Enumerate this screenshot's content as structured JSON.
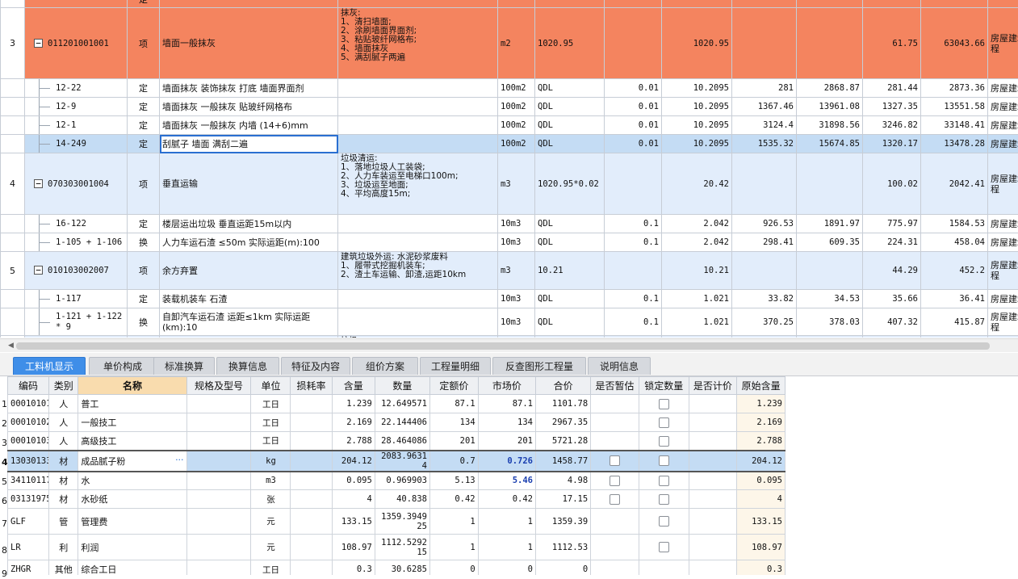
{
  "top_rows": [
    {
      "type": "orange",
      "rn": "",
      "code": "",
      "kind": "定",
      "name": "",
      "desc": "",
      "unit": "",
      "qty_expr": "",
      "content": "",
      "qty": "",
      "unit_price": "",
      "total": "",
      "composite_price": "",
      "composite_total": "",
      "specialty": ""
    },
    {
      "type": "orange",
      "rn": "3",
      "code": "011201001001",
      "toggle": "−",
      "kind": "项",
      "name": "墙面一般抹灰",
      "desc": "抹灰:\n1、清扫墙面;\n2、涂刷墙面界面剂;\n3、粘贴玻纤网格布;\n4、墙面抹灰\n5、满刮腻子两遍",
      "unit": "m2",
      "qty_expr": "1020.95",
      "content": "",
      "qty": "1020.95",
      "unit_price": "",
      "total": "",
      "composite_price": "61.75",
      "composite_total": "63043.66",
      "specialty": "房屋建筑工程"
    },
    {
      "type": "white",
      "rn": "",
      "code": "12-22",
      "kind": "定",
      "name": "墙面抹灰 装饰抹灰 打底 墙面界面剂",
      "desc": "",
      "unit": "100m2",
      "qty_expr": "QDL",
      "content": "0.01",
      "qty": "10.2095",
      "unit_price": "281",
      "total": "2868.87",
      "composite_price": "281.44",
      "composite_total": "2873.36",
      "specialty": "房屋建筑"
    },
    {
      "type": "white",
      "rn": "",
      "code": "12-9",
      "kind": "定",
      "name": "墙面抹灰 一般抹灰 贴玻纤网格布",
      "desc": "",
      "unit": "100m2",
      "qty_expr": "QDL",
      "content": "0.01",
      "qty": "10.2095",
      "unit_price": "1367.46",
      "total": "13961.08",
      "composite_price": "1327.35",
      "composite_total": "13551.58",
      "specialty": "房屋建筑"
    },
    {
      "type": "white",
      "rn": "",
      "code": "12-1",
      "kind": "定",
      "name": "墙面抹灰 一般抹灰 内墙 (14+6)mm",
      "desc": "",
      "unit": "100m2",
      "qty_expr": "QDL",
      "content": "0.01",
      "qty": "10.2095",
      "unit_price": "3124.4",
      "total": "31898.56",
      "composite_price": "3246.82",
      "composite_total": "33148.41",
      "specialty": "房屋建筑"
    },
    {
      "type": "selected",
      "rn": "",
      "code": "14-249",
      "kind": "定",
      "name": "刮腻子 墙面 满刮二遍",
      "desc": "",
      "unit": "100m2",
      "qty_expr": "QDL",
      "content": "0.01",
      "qty": "10.2095",
      "unit_price": "1535.32",
      "total": "15674.85",
      "composite_price": "1320.17",
      "composite_total": "13478.28",
      "specialty": "房屋建筑"
    },
    {
      "type": "blue",
      "rn": "4",
      "code": "070303001004",
      "toggle": "−",
      "kind": "项",
      "name": "垂直运输",
      "desc": "垃圾清运:\n1、落地垃圾人工装袋;\n2、人力车装运至电梯口100m;\n3、垃圾运至地面;\n4、平均高度15m;",
      "unit": "m3",
      "qty_expr": "1020.95*0.02",
      "content": "",
      "qty": "20.42",
      "unit_price": "",
      "total": "",
      "composite_price": "100.02",
      "composite_total": "2042.41",
      "specialty": "房屋建筑工程"
    },
    {
      "type": "white",
      "rn": "",
      "code": "16-122",
      "kind": "定",
      "name": "楼层运出垃圾 垂直运距15m以内",
      "desc": "",
      "unit": "10m3",
      "qty_expr": "QDL",
      "content": "0.1",
      "qty": "2.042",
      "unit_price": "926.53",
      "total": "1891.97",
      "composite_price": "775.97",
      "composite_total": "1584.53",
      "specialty": "房屋建筑"
    },
    {
      "type": "white",
      "rn": "",
      "code": "1-105 + 1-106",
      "kind": "换",
      "name": "人力车运石渣 ≤50m  实际运距(m):100",
      "desc": "",
      "unit": "10m3",
      "qty_expr": "QDL",
      "content": "0.1",
      "qty": "2.042",
      "unit_price": "298.41",
      "total": "609.35",
      "composite_price": "224.31",
      "composite_total": "458.04",
      "specialty": "房屋建筑"
    },
    {
      "type": "blue",
      "rn": "5",
      "code": "010103002007",
      "toggle": "−",
      "kind": "项",
      "name": "余方弃置",
      "desc": "建筑垃圾外运: 水泥砂浆废料\n1、履带式挖掘机装车;\n2、渣土车运输、卸渣,运距10km",
      "unit": "m3",
      "qty_expr": "10.21",
      "content": "",
      "qty": "10.21",
      "unit_price": "",
      "total": "",
      "composite_price": "44.29",
      "composite_total": "452.2",
      "specialty": "房屋建筑工程"
    },
    {
      "type": "white",
      "rn": "",
      "code": "1-117",
      "kind": "定",
      "name": "装载机装车 石渣",
      "desc": "",
      "unit": "10m3",
      "qty_expr": "QDL",
      "content": "0.1",
      "qty": "1.021",
      "unit_price": "33.82",
      "total": "34.53",
      "composite_price": "35.66",
      "composite_total": "36.41",
      "specialty": "房屋建筑"
    },
    {
      "type": "white",
      "rn": "",
      "code": "1-121 + 1-122 * 9",
      "kind": "换",
      "name": "自卸汽车运石渣 运距≤1km  实际运距(km):10",
      "desc": "",
      "unit": "10m3",
      "qty_expr": "QDL",
      "content": "0.1",
      "qty": "1.021",
      "unit_price": "370.25",
      "total": "378.03",
      "composite_price": "407.32",
      "composite_total": "415.87",
      "specialty": "房屋建筑工程"
    },
    {
      "type": "blue",
      "rn": "",
      "code": "",
      "kind": "",
      "name": "",
      "desc": "垃圾…",
      "unit": "",
      "qty_expr": "",
      "content": "",
      "qty": "",
      "unit_price": "",
      "total": "",
      "composite_price": "",
      "composite_total": "",
      "specialty": ""
    }
  ],
  "tabs": [
    "工料机显示",
    "单价构成",
    "标准换算",
    "换算信息",
    "特征及内容",
    "组价方案",
    "工程量明细",
    "反查图形工程量",
    "说明信息"
  ],
  "bottom_headers": [
    "编码",
    "类别",
    "名称",
    "规格及型号",
    "单位",
    "损耗率",
    "含量",
    "数量",
    "定额价",
    "市场价",
    "合价",
    "是否暂估",
    "锁定数量",
    "是否计价",
    "原始含量"
  ],
  "bottom_rows": [
    {
      "rn": "1",
      "code": "00010101",
      "cat": "人",
      "name": "普工",
      "spec": "",
      "unit": "工日",
      "loss": "",
      "content": "1.239",
      "qty": "12.649571",
      "quota": "87.1",
      "market": "87.1",
      "market_bold": false,
      "total": "1101.78",
      "est": false,
      "lock": true,
      "orig": "1.239"
    },
    {
      "rn": "2",
      "code": "00010102",
      "cat": "人",
      "name": "一般技工",
      "spec": "",
      "unit": "工日",
      "loss": "",
      "content": "2.169",
      "qty": "22.144406",
      "quota": "134",
      "market": "134",
      "market_bold": false,
      "total": "2967.35",
      "est": false,
      "lock": true,
      "orig": "2.169"
    },
    {
      "rn": "3",
      "code": "00010103",
      "cat": "人",
      "name": "高级技工",
      "spec": "",
      "unit": "工日",
      "loss": "",
      "content": "2.788",
      "qty": "28.464086",
      "quota": "201",
      "market": "201",
      "market_bold": false,
      "total": "5721.28",
      "est": false,
      "lock": true,
      "orig": "2.788"
    },
    {
      "rn": "4",
      "code": "13030133",
      "cat": "材",
      "name": "成品腻子粉",
      "spec": "",
      "unit": "kg",
      "loss": "",
      "content": "204.12",
      "qty": "2083.96314",
      "quota": "0.7",
      "market": "0.726",
      "market_bold": true,
      "total": "1458.77",
      "est": true,
      "lock": true,
      "orig": "204.12",
      "selected": true
    },
    {
      "rn": "5",
      "code": "34110117",
      "cat": "材",
      "name": "水",
      "spec": "",
      "unit": "m3",
      "loss": "",
      "content": "0.095",
      "qty": "0.969903",
      "quota": "5.13",
      "market": "5.46",
      "market_bold": true,
      "total": "4.98",
      "est": true,
      "lock": true,
      "orig": "0.095"
    },
    {
      "rn": "6",
      "code": "03131975",
      "cat": "材",
      "name": "水砂纸",
      "spec": "",
      "unit": "张",
      "loss": "",
      "content": "4",
      "qty": "40.838",
      "quota": "0.42",
      "market": "0.42",
      "market_bold": false,
      "total": "17.15",
      "est": true,
      "lock": true,
      "orig": "4"
    },
    {
      "rn": "7",
      "code": "GLF",
      "cat": "管",
      "name": "管理费",
      "spec": "",
      "unit": "元",
      "loss": "",
      "content": "133.15",
      "qty": "1359.394925",
      "quota": "1",
      "market": "1",
      "market_bold": false,
      "total": "1359.39",
      "est": false,
      "lock": true,
      "orig": "133.15",
      "tall": true
    },
    {
      "rn": "8",
      "code": "LR",
      "cat": "利",
      "name": "利润",
      "spec": "",
      "unit": "元",
      "loss": "",
      "content": "108.97",
      "qty": "1112.529215",
      "quota": "1",
      "market": "1",
      "market_bold": false,
      "total": "1112.53",
      "est": false,
      "lock": true,
      "orig": "108.97",
      "tall": true
    },
    {
      "rn": "9",
      "code": "ZHGR",
      "cat": "其他",
      "name": "综合工日",
      "spec": "",
      "unit": "工日",
      "loss": "",
      "content": "0.3",
      "qty": "30.6285",
      "quota": "0",
      "market": "0",
      "market_bold": false,
      "total": "0",
      "est": false,
      "lock": false,
      "orig": "0.3"
    }
  ]
}
